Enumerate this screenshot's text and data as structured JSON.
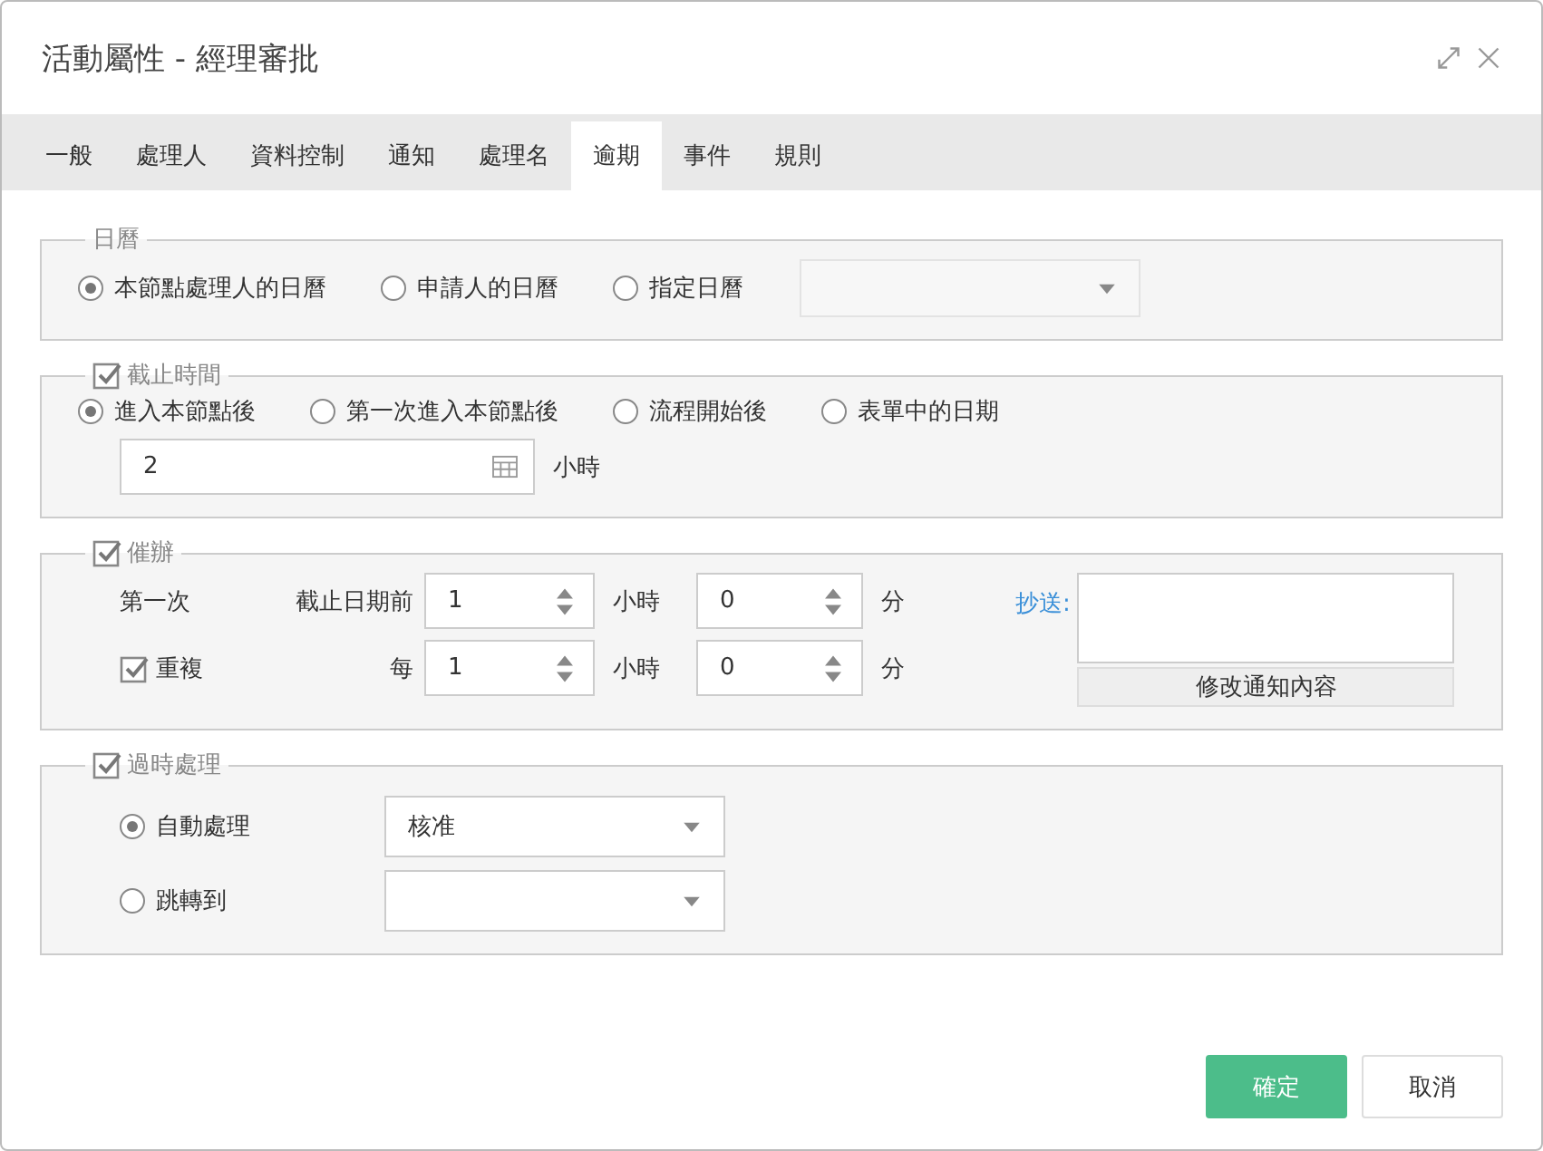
{
  "dialog": {
    "title": "活動屬性 - 經理審批"
  },
  "tabs": [
    {
      "label": "一般",
      "selected": false
    },
    {
      "label": "處理人",
      "selected": false
    },
    {
      "label": "資料控制",
      "selected": false
    },
    {
      "label": "通知",
      "selected": false
    },
    {
      "label": "處理名",
      "selected": false
    },
    {
      "label": "逾期",
      "selected": true
    },
    {
      "label": "事件",
      "selected": false
    },
    {
      "label": "規則",
      "selected": false
    }
  ],
  "calendar": {
    "legend": "日曆",
    "options": [
      {
        "label": "本節點處理人的日曆",
        "selected": true
      },
      {
        "label": "申請人的日曆",
        "selected": false
      },
      {
        "label": "指定日曆",
        "selected": false
      }
    ],
    "calendar_select": {
      "disabled": true
    }
  },
  "deadline": {
    "legend": "截止時間",
    "checked": true,
    "options": [
      {
        "label": "進入本節點後",
        "selected": true
      },
      {
        "label": "第一次進入本節點後",
        "selected": false
      },
      {
        "label": "流程開始後",
        "selected": false
      },
      {
        "label": "表單中的日期",
        "selected": false
      }
    ],
    "value": "2",
    "unit": "小時"
  },
  "reminder": {
    "legend": "催辦",
    "checked": true,
    "rows": [
      {
        "kind": "text",
        "label": "第一次",
        "prefix": "截止日期前",
        "hours": "1",
        "hours_unit": "小時",
        "minutes": "0",
        "minutes_unit": "分"
      },
      {
        "kind": "checkbox",
        "label": "重複",
        "checked": true,
        "prefix": "每",
        "hours": "1",
        "hours_unit": "小時",
        "minutes": "0",
        "minutes_unit": "分"
      }
    ],
    "cc_label": "抄送:",
    "edit_button": "修改通知內容"
  },
  "overdue": {
    "legend": "過時處理",
    "checked": true,
    "options": [
      {
        "label": "自動處理",
        "selected": true,
        "value": "核准"
      },
      {
        "label": "跳轉到",
        "selected": false
      }
    ]
  },
  "buttons": [
    {
      "label": "確定",
      "kind": "primary"
    },
    {
      "label": "取消",
      "kind": "default"
    }
  ]
}
